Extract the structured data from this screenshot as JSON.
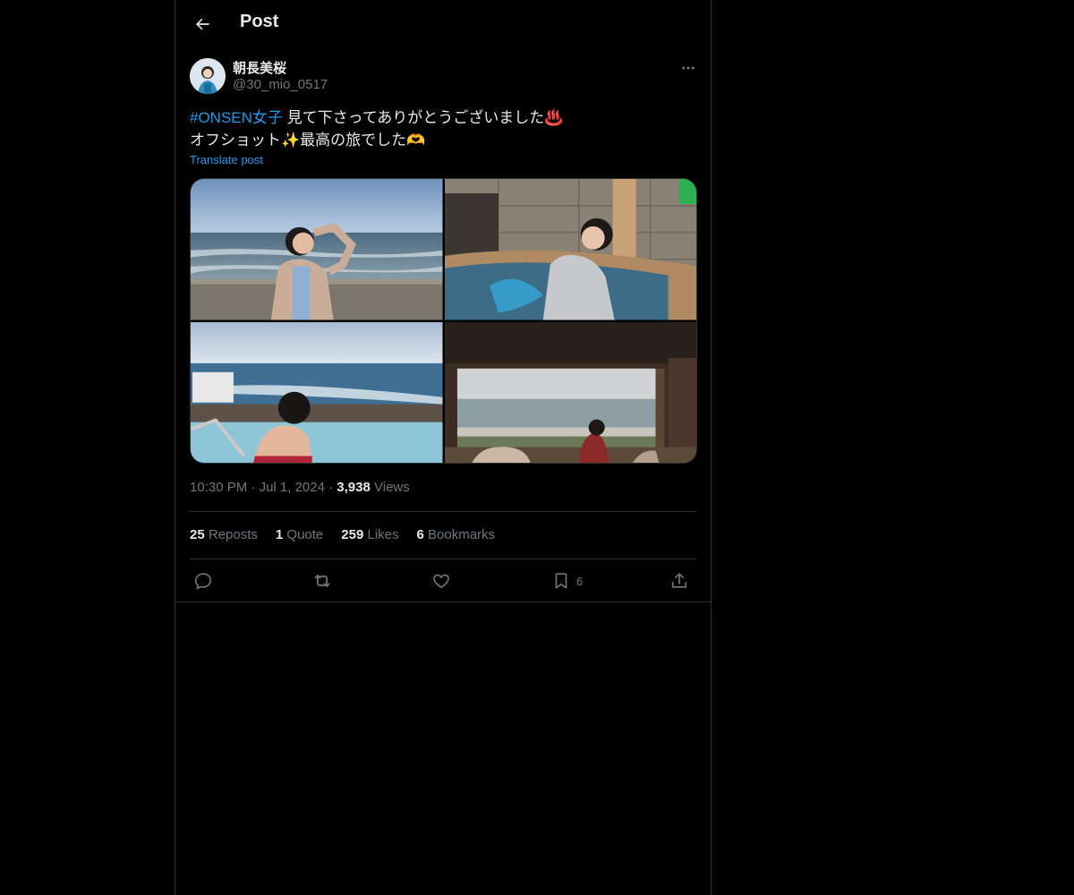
{
  "header": {
    "title": "Post",
    "back_icon": "arrow-left-icon"
  },
  "author": {
    "display_name": "朝長美桜",
    "handle": "@30_mio_0517",
    "avatar_icon": "avatar"
  },
  "post": {
    "hashtag": "#ONSEN女子",
    "line1_rest": " 見て下さってありがとうございました♨️",
    "line2": "オフショット✨最高の旅でした🫶",
    "translate_label": "Translate post"
  },
  "media": [
    {
      "name": "photo-beach-seawall"
    },
    {
      "name": "photo-onsen-bath"
    },
    {
      "name": "photo-infinity-pool"
    },
    {
      "name": "photo-window-ocean-view"
    }
  ],
  "meta": {
    "time": "10:30 PM",
    "date": "Jul 1, 2024",
    "views_count": "3,938",
    "views_label": "Views",
    "sep": " · "
  },
  "stats": {
    "reposts_count": "25",
    "reposts_label": "Reposts",
    "quotes_count": "1",
    "quotes_label": "Quote",
    "likes_count": "259",
    "likes_label": "Likes",
    "bookmarks_count": "6",
    "bookmarks_label": "Bookmarks"
  },
  "actions": {
    "reply_icon": "reply-icon",
    "repost_icon": "repost-icon",
    "like_icon": "heart-icon",
    "bookmark_icon": "bookmark-icon",
    "bookmark_count": "6",
    "share_icon": "share-icon"
  },
  "colors": {
    "accent": "#1d9bf0",
    "text": "#e7e9ea",
    "muted": "#71767b",
    "border": "#2f3336",
    "background": "#000000"
  }
}
